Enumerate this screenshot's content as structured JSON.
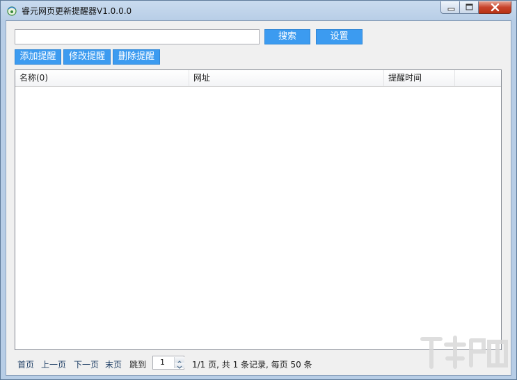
{
  "window": {
    "title": "睿元网页更新提醒器V1.0.0.0"
  },
  "toolbar": {
    "search_value": "",
    "search_button": "搜索",
    "settings_button": "设置",
    "add_button": "添加提醒",
    "edit_button": "修改提醒",
    "delete_button": "删除提醒"
  },
  "list": {
    "columns": [
      "名称(0)",
      "网址",
      "提醒时间",
      ""
    ],
    "rows": []
  },
  "pager": {
    "first": "首页",
    "prev": "上一页",
    "next": "下一页",
    "last": "末页",
    "jump_label": "跳到",
    "page_input": "1",
    "summary": "1/1 页, 共 1 条记录, 每页 50 条"
  },
  "icons": {
    "app": "app-icon",
    "minimize": "minimize-icon",
    "maximize": "maximize-icon",
    "close": "close-icon",
    "spin_up": "chevron-up-icon",
    "spin_down": "chevron-down-icon"
  },
  "colors": {
    "button_blue": "#3c9bf0",
    "close_red": "#c7432b"
  }
}
